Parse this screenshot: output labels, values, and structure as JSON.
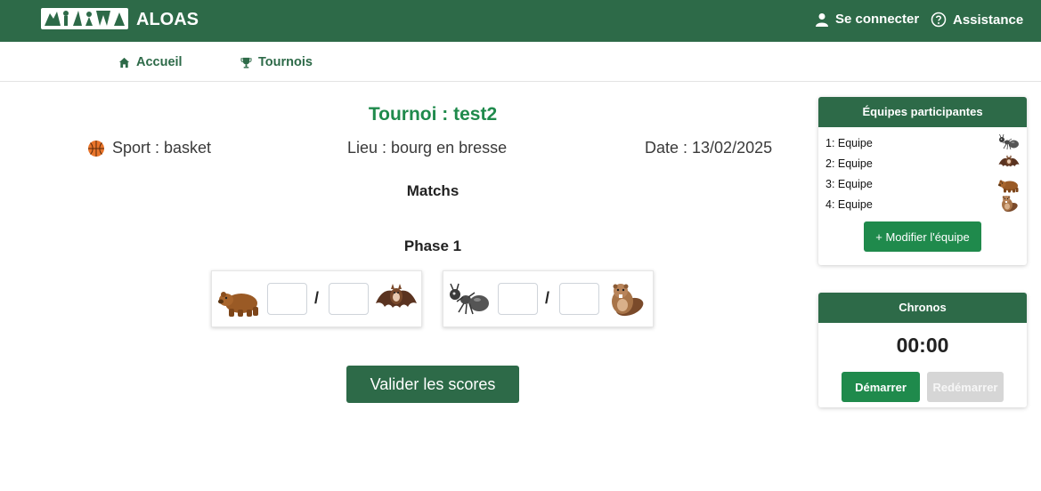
{
  "header": {
    "brand": "ALOAS",
    "login_label": "Se connecter",
    "help_label": "Assistance"
  },
  "nav": {
    "home_label": "Accueil",
    "tournaments_label": "Tournois"
  },
  "tournament": {
    "title": "Tournoi : test2",
    "sport": "Sport : basket",
    "place": "Lieu : bourg en bresse",
    "date": "Date : 13/02/2025"
  },
  "matches": {
    "heading": "Matchs",
    "phase_label": "Phase 1",
    "list": [
      {
        "team_a_icon": "bear-icon",
        "team_b_icon": "bat-icon",
        "score_a": "",
        "score_b": "",
        "separator": "/"
      },
      {
        "team_a_icon": "ant-icon",
        "team_b_icon": "beaver-icon",
        "score_a": "",
        "score_b": "",
        "separator": "/"
      }
    ],
    "validate_label": "Valider les scores"
  },
  "teams_panel": {
    "title": "Équipes participantes",
    "teams": [
      {
        "label": "1: Equipe",
        "icon": "ant-icon"
      },
      {
        "label": "2: Equipe",
        "icon": "bat-icon"
      },
      {
        "label": "3: Equipe",
        "icon": "bear-icon"
      },
      {
        "label": "4: Equipe",
        "icon": "beaver-icon"
      }
    ],
    "modify_label": "+ Modifier l'équipe"
  },
  "chronos": {
    "title": "Chronos",
    "time": "00:00",
    "start_label": "Démarrer",
    "restart_label": "Redémarrer"
  },
  "colors": {
    "primary": "#2d6a48",
    "accent": "#1f8a4c",
    "disabled": "#d6d6d6"
  }
}
